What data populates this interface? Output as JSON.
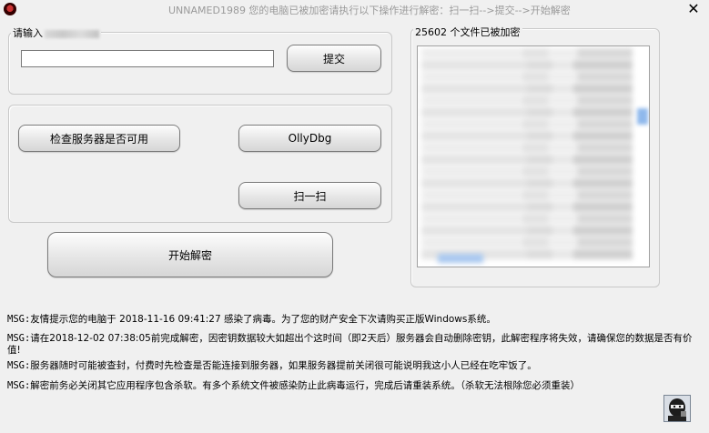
{
  "window": {
    "title": "UNNAMED1989  您的电脑已被加密请执行以下操作进行解密：扫一扫-->提交-->开始解密",
    "close_glyph": "✕"
  },
  "input_group": {
    "legend": "请输入",
    "input_value": "",
    "submit_label": "提交"
  },
  "tools_group": {
    "check_server_label": "检查服务器是否可用",
    "ollydbg_label": "OllyDbg",
    "scan_label": "扫一扫"
  },
  "start_decrypt_label": "开始解密",
  "files_group": {
    "legend": "25602 个文件已被加密"
  },
  "messages": [
    {
      "tag": "MSG:",
      "text": "友情提示您的电脑于 2018-11-16 09:41:27  感染了病毒。为了您的财产安全下次请购买正版Windows系统。"
    },
    {
      "tag": "MSG:",
      "text": "请在2018-12-02 07:38:05前完成解密，因密钥数据较大如超出个这时间（即2天后）服务器会自动删除密钥，此解密程序将失效，请确保您的数据是否有价",
      "text2": "值!"
    },
    {
      "tag": "MSG:",
      "text": "服务器随时可能被查封，付费时先检查是否能连接到服务器，如果服务器提前关闭很可能说明我这小人已经在吃牢饭了。"
    },
    {
      "tag": "MSG:",
      "text": "解密前务必关闭其它应用程序包含杀软。有多个系统文件被感染防止此病毒运行，完成后请重装系统。（杀软无法根除您必须重装）"
    }
  ],
  "icons": {
    "app": "virus-app-icon",
    "avatar": "hacker-avatar-icon"
  },
  "colors": {
    "window_bg": "#f0f0f0",
    "title_text": "#9a9a9a",
    "scroll_accent": "#8fb8ec"
  }
}
